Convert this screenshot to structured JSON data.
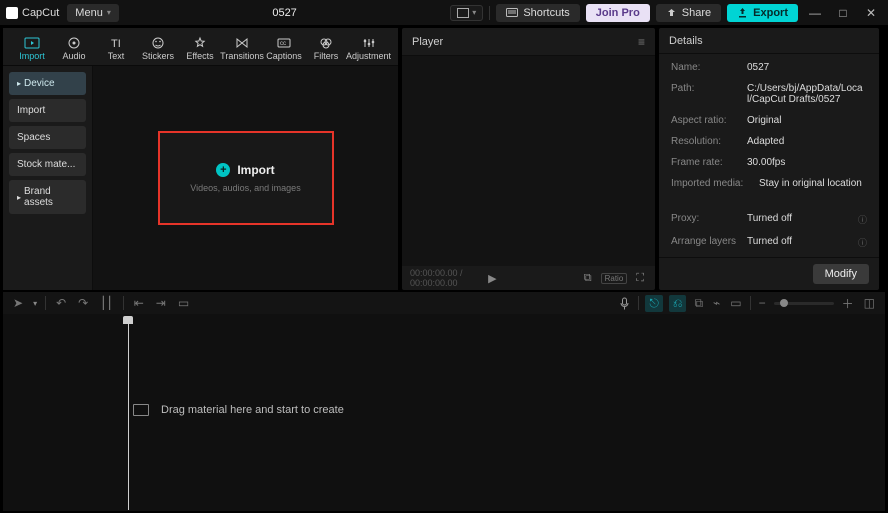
{
  "titlebar": {
    "app_name": "CapCut",
    "menu_label": "Menu",
    "project_title": "0527",
    "shortcuts_label": "Shortcuts",
    "join_pro_label": "Join Pro",
    "share_label": "Share",
    "export_label": "Export"
  },
  "media_tabs": [
    {
      "label": "Import",
      "icon": "import-icon"
    },
    {
      "label": "Audio",
      "icon": "audio-icon"
    },
    {
      "label": "Text",
      "icon": "text-icon"
    },
    {
      "label": "Stickers",
      "icon": "stickers-icon"
    },
    {
      "label": "Effects",
      "icon": "effects-icon"
    },
    {
      "label": "Transitions",
      "icon": "transitions-icon"
    },
    {
      "label": "Captions",
      "icon": "captions-icon"
    },
    {
      "label": "Filters",
      "icon": "filters-icon"
    },
    {
      "label": "Adjustment",
      "icon": "adjustment-icon"
    }
  ],
  "sidebar": {
    "items": [
      {
        "label": "Device",
        "active": true,
        "chevron": true
      },
      {
        "label": "Import"
      },
      {
        "label": "Spaces"
      },
      {
        "label": "Stock mate..."
      },
      {
        "label": "Brand assets",
        "chevron": true
      }
    ]
  },
  "import_box": {
    "title": "Import",
    "subtitle": "Videos, audios, and images"
  },
  "player": {
    "header": "Player",
    "timecode": "00:00:00.00 / 00:00:00.00",
    "ratio_label": "Ratio"
  },
  "details": {
    "header": "Details",
    "rows": {
      "name_key": "Name:",
      "name_val": "0527",
      "path_key": "Path:",
      "path_val": "C:/Users/bj/AppData/Local/CapCut Drafts/0527",
      "aspect_key": "Aspect ratio:",
      "aspect_val": "Original",
      "res_key": "Resolution:",
      "res_val": "Adapted",
      "fps_key": "Frame rate:",
      "fps_val": "30.00fps",
      "imported_key": "Imported media:",
      "imported_val": "Stay in original location",
      "proxy_key": "Proxy:",
      "proxy_val": "Turned off",
      "layers_key": "Arrange layers",
      "layers_val": "Turned off"
    },
    "modify_label": "Modify"
  },
  "timeline": {
    "hint": "Drag material here and start to create"
  }
}
